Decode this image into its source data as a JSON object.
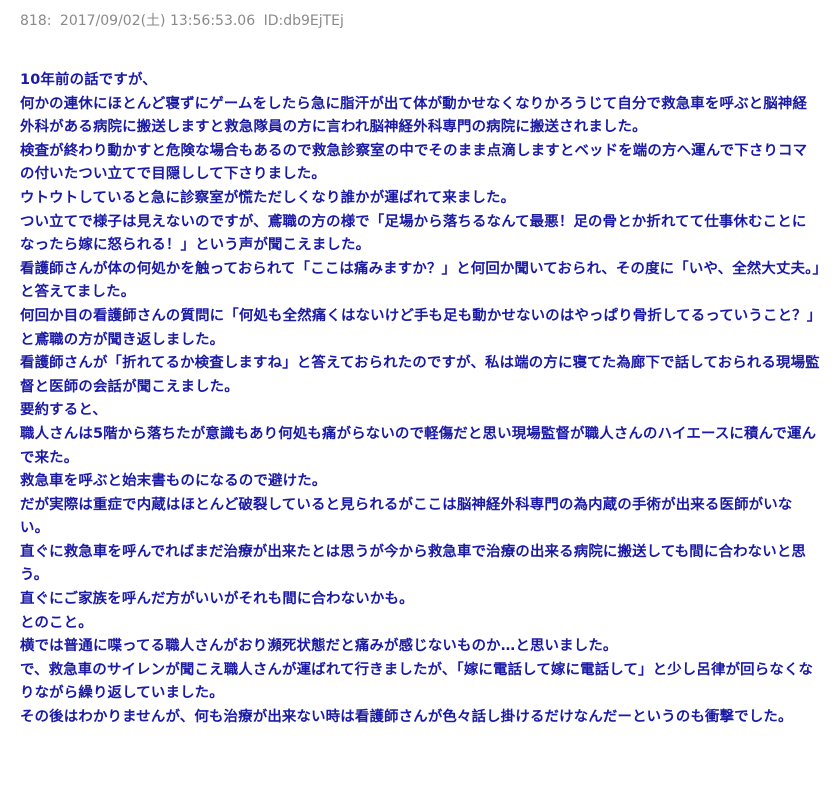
{
  "post": {
    "number": "818:",
    "datetime": "2017/09/02(土) 13:56:53.06",
    "id": "ID:db9EjTEj",
    "lines": [
      "10年前の話ですが、",
      "何かの連休にほとんど寝ずにゲームをしたら急に脂汗が出て体が動かせなくなりかろうじて自分で救急車を呼ぶと脳神経外科がある病院に搬送しますと救急隊員の方に言われ脳神経外科専門の病院に搬送されました。",
      "検査が終わり動かすと危険な場合もあるので救急診察室の中でそのまま点滴しますとベッドを端の方へ運んで下さりコマの付いたつい立てで目隠しして下さりました。",
      "ウトウトしていると急に診察室が慌ただしくなり誰かが運ばれて来ました。",
      "つい立てで様子は見えないのですが、鳶職の方の様で「足場から落ちるなんて最悪！足の骨とか折れてて仕事休むことになったら嫁に怒られる！」という声が聞こえました。",
      "看護師さんが体の何処かを触っておられて「ここは痛みますか？」と何回か聞いておられ、その度に「いや、全然大丈夫。」と答えてました。",
      "何回か目の看護師さんの質問に「何処も全然痛くはないけど手も足も動かせないのはやっぱり骨折してるっていうこと？」と鳶職の方が聞き返しました。",
      "看護師さんが「折れてるか検査しますね」と答えておられたのですが、私は端の方に寝てた為廊下で話しておられる現場監督と医師の会話が聞こえました。",
      "要約すると、",
      "職人さんは5階から落ちたが意識もあり何処も痛がらないので軽傷だと思い現場監督が職人さんのハイエースに積んで運んで来た。",
      "救急車を呼ぶと始末書ものになるので避けた。",
      "だが実際は重症で内蔵はほとんど破裂していると見られるがここは脳神経外科専門の為内蔵の手術が出来る医師がいない。",
      "直ぐに救急車を呼んでればまだ治療が出来たとは思うが今から救急車で治療の出来る病院に搬送しても間に合わないと思う。",
      "直ぐにご家族を呼んだ方がいいがそれも間に合わないかも。",
      "とのこと。",
      "横では普通に喋ってる職人さんがおり瀕死状態だと痛みが感じないものか…と思いました。",
      "で、救急車のサイレンが聞こえ職人さんが運ばれて行きましたが、「嫁に電話して嫁に電話して」と少し呂律が回らなくなりながら繰り返していました。",
      "その後はわかりませんが、何も治療が出来ない時は看護師さんが色々話し掛けるだけなんだーというのも衝撃でした。"
    ]
  },
  "colors": {
    "header_text": "#8a8a8a",
    "body_text": "#1a1aa6",
    "background": "#ffffff"
  }
}
